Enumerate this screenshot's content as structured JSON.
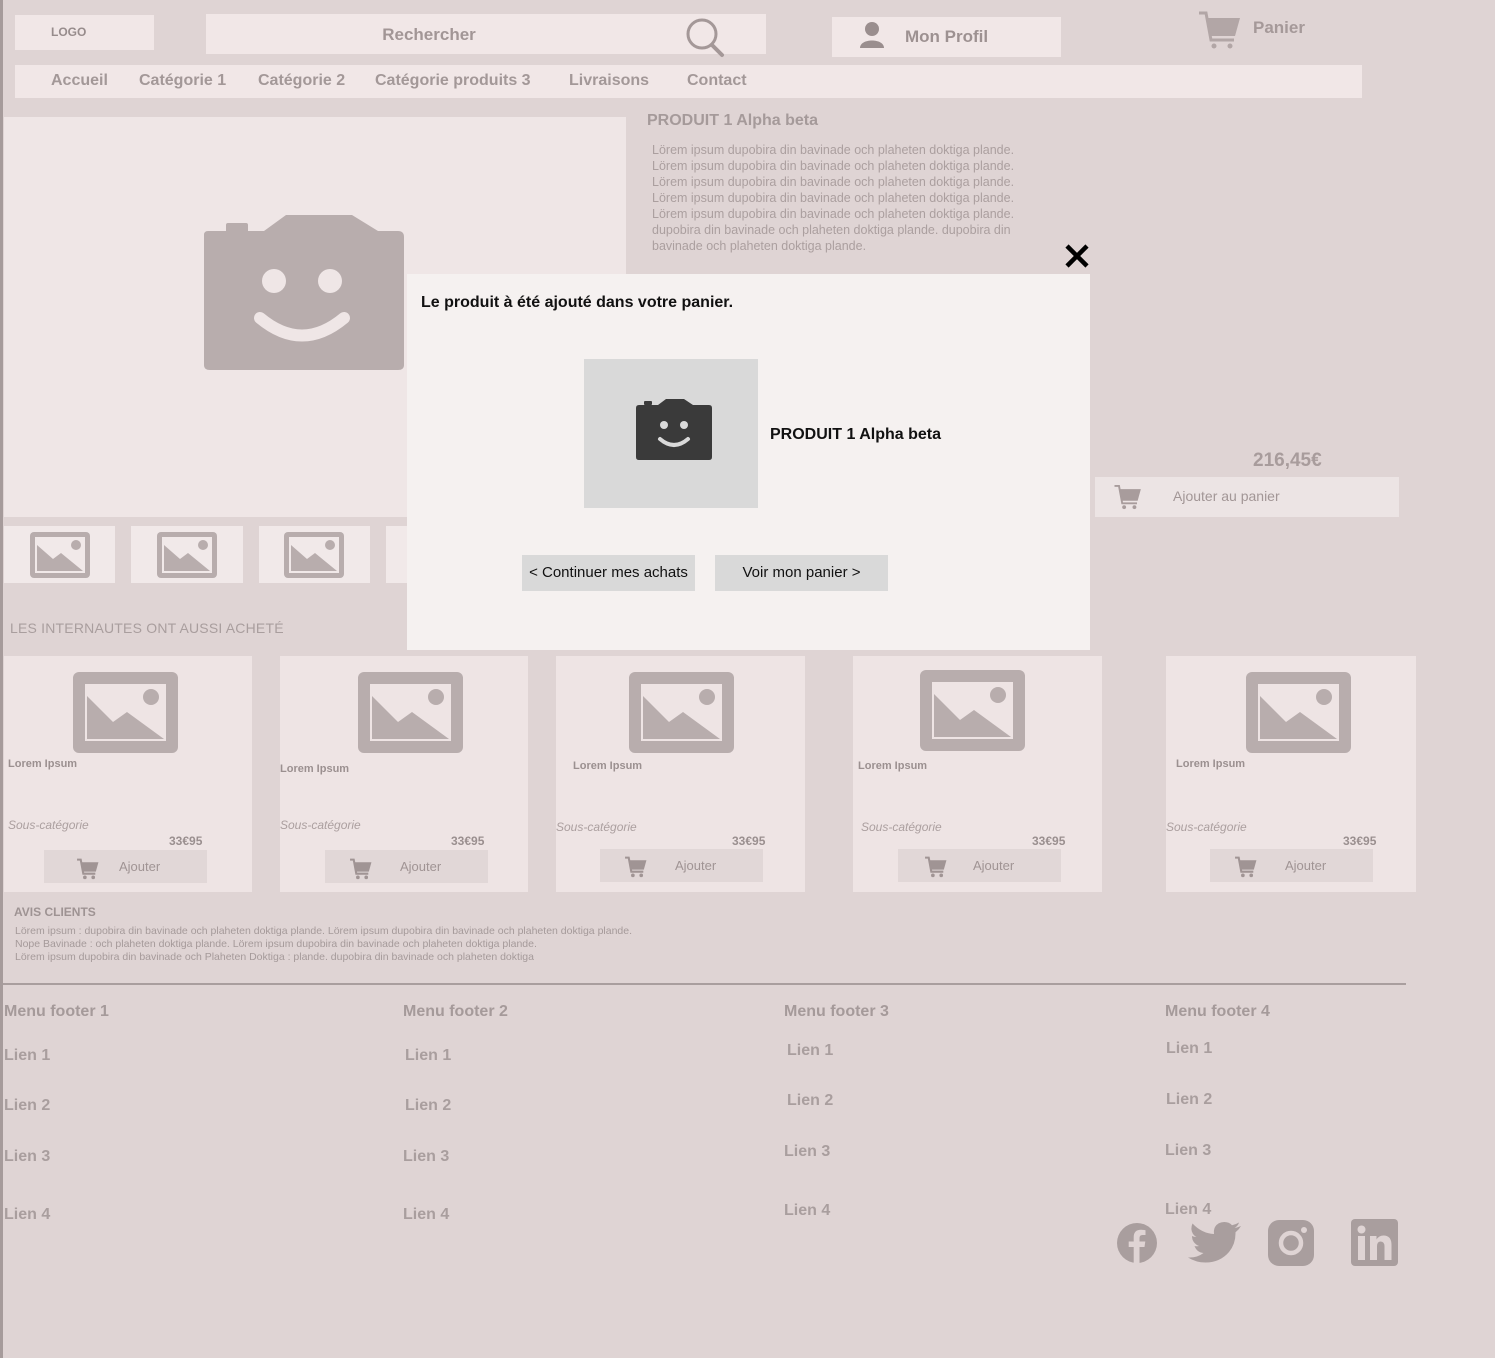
{
  "header": {
    "logo": "LOGO",
    "search_placeholder": "Rechercher",
    "profile_label": "Mon Profil",
    "cart_label": "Panier"
  },
  "nav": [
    "Accueil",
    "Catégorie 1",
    "Catégorie 2",
    "Catégorie produits 3",
    "Livraisons",
    "Contact"
  ],
  "product": {
    "title": "PRODUIT 1 Alpha beta",
    "description": [
      "Lörem ipsum dupobira din bavinade och plaheten doktiga plande.",
      "Lörem ipsum dupobira din bavinade och plaheten doktiga plande.",
      "Lörem ipsum dupobira din bavinade och plaheten doktiga plande.",
      "Lörem ipsum dupobira din bavinade och plaheten doktiga plande.",
      "Lörem ipsum dupobira din bavinade och plaheten doktiga plande.",
      "dupobira din bavinade och plaheten doktiga plande. dupobira din",
      "bavinade och plaheten doktiga plande."
    ],
    "price": "216,45€",
    "add_to_cart": "Ajouter au panier"
  },
  "also_bought": {
    "title": "LES INTERNAUTES ONT AUSSI ACHETÉ",
    "cards": [
      {
        "name": "Lorem Ipsum",
        "sub": "Sous-catégorie",
        "price": "33€95",
        "button": "Ajouter"
      },
      {
        "name": "Lorem Ipsum",
        "sub": "Sous-catégorie",
        "price": "33€95",
        "button": "Ajouter"
      },
      {
        "name": "Lorem Ipsum",
        "sub": "Sous-catégorie",
        "price": "33€95",
        "button": "Ajouter"
      },
      {
        "name": "Lorem Ipsum",
        "sub": "Sous-catégorie",
        "price": "33€95",
        "button": "Ajouter"
      },
      {
        "name": "Lorem Ipsum",
        "sub": "Sous-catégorie",
        "price": "33€95",
        "button": "Ajouter"
      }
    ]
  },
  "reviews": {
    "title": "AVIS CLIENTS",
    "lines": [
      "Lörem ipsum : dupobira din bavinade och plaheten doktiga plande. Lörem ipsum dupobira din bavinade och plaheten doktiga plande.",
      "Nope Bavinade : och plaheten doktiga plande. Lörem ipsum dupobira din bavinade och plaheten doktiga plande.",
      "Lörem ipsum dupobira din bavinade och Plaheten Doktiga : plande. dupobira din bavinade och plaheten doktiga"
    ]
  },
  "footer": {
    "columns": [
      {
        "title": "Menu footer 1",
        "links": [
          "Lien 1",
          "Lien 2",
          "Lien 3",
          "Lien 4"
        ]
      },
      {
        "title": "Menu footer 2",
        "links": [
          "Lien 1",
          "Lien 2",
          "Lien 3",
          "Lien 4"
        ]
      },
      {
        "title": "Menu footer 3",
        "links": [
          "Lien 1",
          "Lien 2",
          "Lien 3",
          "Lien 4"
        ]
      },
      {
        "title": "Menu footer 4",
        "links": [
          "Lien 1",
          "Lien 2",
          "Lien 3",
          "Lien 4"
        ]
      }
    ],
    "social": [
      "facebook-icon",
      "twitter-icon",
      "instagram-icon",
      "linkedin-icon"
    ]
  },
  "modal": {
    "message": "Le produit à été ajouté dans votre panier.",
    "product_name": "PRODUIT 1 Alpha beta",
    "continue_button": "< Continuer mes achats",
    "view_cart_button": "Voir mon panier >"
  },
  "colors": {
    "background": "#dfd4d4",
    "placeholder_gray": "#b8adad",
    "modal_bg": "#f5f1f0",
    "button_gray": "#d9d9d9"
  }
}
